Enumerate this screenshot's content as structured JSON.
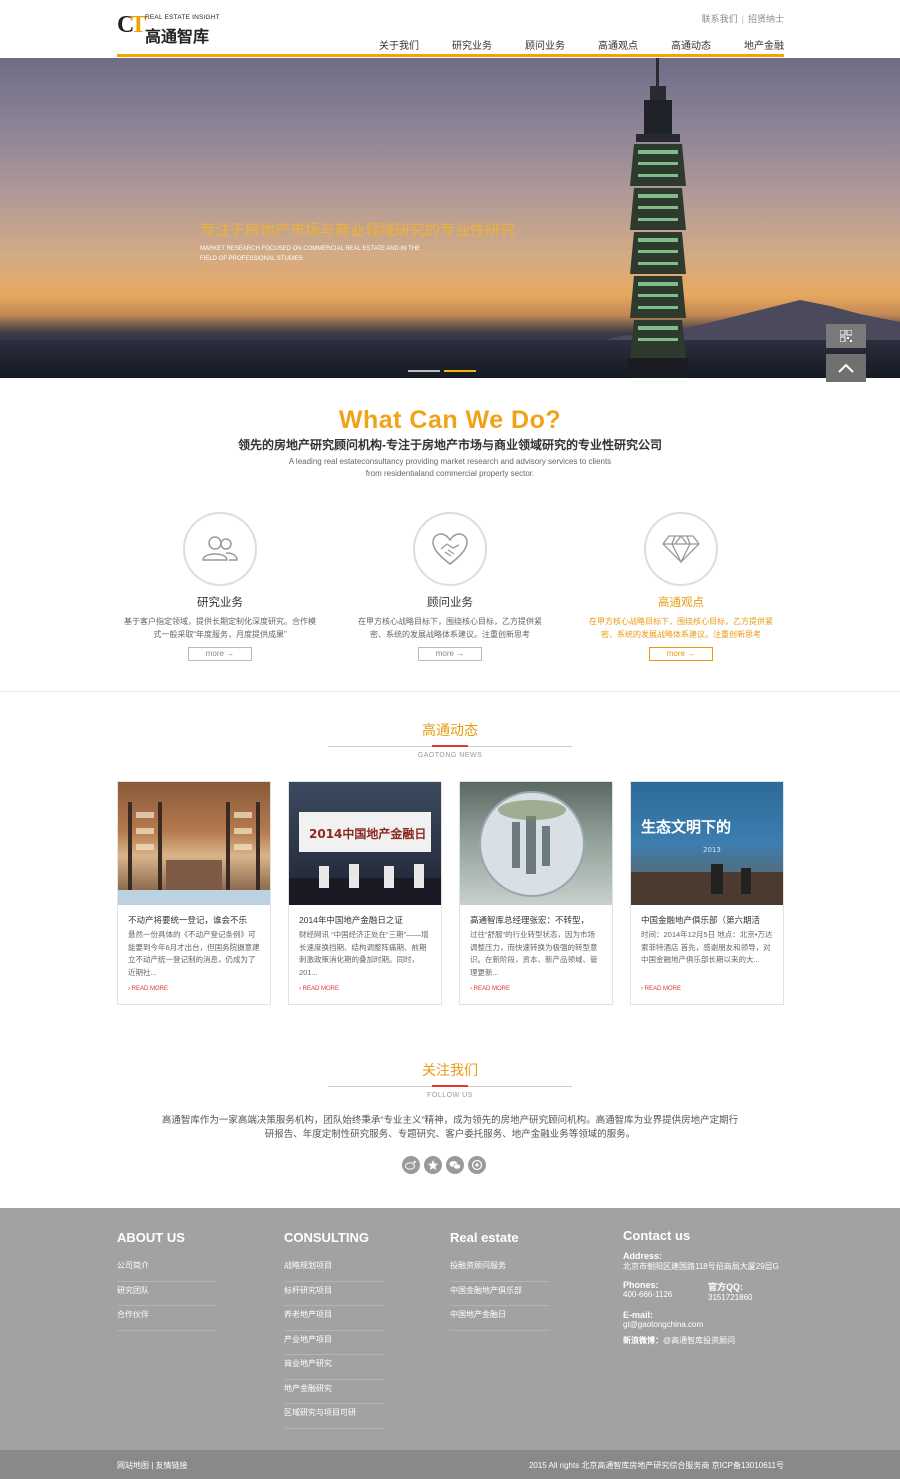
{
  "header": {
    "logo_ct": "CT",
    "logo_en": "REAL ESTATE INSIGHT",
    "logo_cn": "高通智库",
    "top_links": [
      "联系我们",
      "招贤纳士"
    ],
    "nav": [
      "关于我们",
      "研究业务",
      "顾问业务",
      "高通观点",
      "高通动态",
      "地产金融"
    ]
  },
  "banner": {
    "title": "专注于房地产市场与商业领域研究的专业性研究",
    "subtitle": "MARKET RESEARCH FOCUSED ON COMMERCIAL REAL ESTATE AND IN THE FIELD OF PROFESSIONAL STUDIES"
  },
  "what": {
    "heading": "What Can We Do?",
    "subheading": "领先的房地产研究顾问机构-专注于房地产市场与商业领域研究的专业性研究公司",
    "english": "A leading real estateconsultancy providing market research and advisory services to clients from residentialand commercial property sector."
  },
  "services": [
    {
      "title": "研究业务",
      "desc": "基于客户指定领域，提供长期定制化深度研究。合作模式一般采取“年度服务，月度提供成果”",
      "more": "more →",
      "icon": "people-icon"
    },
    {
      "title": "顾问业务",
      "desc": "在甲方核心战略目标下，围绕核心目标，乙方提供紧密、系统的发展战略体系建议。注重创新思考",
      "more": "more →",
      "icon": "handshake-heart-icon"
    },
    {
      "title": "高通观点",
      "desc": "在甲方核心战略目标下，围绕核心目标，乙方提供紧密、系统的发展战略体系建议。注重创新思考",
      "more": "more →",
      "icon": "diamond-icon"
    }
  ],
  "news_section": {
    "title": "高通动态",
    "subtitle": "GAOTONG NEWS"
  },
  "news": [
    {
      "title": "不动产将要统一登记，谁会不乐",
      "desc": "悬然一份具体的《不动产登记条例》可能要到今年6月才出台，但国务院摄意建立不动产统一登记制的消息，仍成为了近期社...",
      "more": "READ MORE"
    },
    {
      "title": "2014年中国地产金融日之证",
      "desc": "财经网讯 “中国经济正处在“三期”——增长速度换挡期、结构调整阵痛期、前期刺激政策消化期的叠加时期。同时，201...",
      "more": "READ MORE"
    },
    {
      "title": "高通智库总经理张宏：不转型，",
      "desc": "过往“舒服”的行业转型状态，因为市场调整压力，而快速转换为极强的转型意识。在新阶段，资本、新产品领域、管理更新...",
      "more": "READ MORE"
    },
    {
      "title": "中国金融地产俱乐部（第六期活",
      "desc": "时间：2014年12月5日 地点：北京•万达索菲特酒店 首先，感谢朋友和领导，对中国金融地产俱乐部长期以来的大...",
      "more": "READ MORE"
    }
  ],
  "news_image_text": {
    "slogan": "生态文明下的",
    "year": "2013",
    "poster": "2014中国地产金融日"
  },
  "follow": {
    "title": "关注我们",
    "subtitle": "FOLLOW US",
    "text": "高通智库作为一家高端决策服务机构，团队始终秉承“专业主义”精神，成为领先的房地产研究顾问机构。高通智库为业界提供房地产定期行研报告、年度定制性研究服务、专题研究、客户委托服务、地产金融业务等领域的服务。",
    "icons": [
      "weibo-icon",
      "star-icon",
      "wechat-icon",
      "chat-icon"
    ]
  },
  "footer": {
    "about": {
      "title": "ABOUT US",
      "items": [
        "公司简介",
        "研究团队",
        "合作伙伴"
      ]
    },
    "consulting": {
      "title": "CONSULTING",
      "items": [
        "战略规划项目",
        "标杆研究项目",
        "养老地产项目",
        "产业地产项目",
        "商业地产研究",
        "地产金融研究",
        "区域研究与项目可研"
      ]
    },
    "realestate": {
      "title": "Real estate",
      "items": [
        "投融资顾问服务",
        "中国金融地产俱乐部",
        "中国地产金融日"
      ]
    },
    "contact": {
      "title": "Contact us",
      "address_label": "Address:",
      "address": "北京市朝阳区建国路118号招商局大厦29层G",
      "phone_label": "Phones:",
      "phone": "400-666-1126",
      "qq_label": "官方QQ:",
      "qq": "3151721860",
      "email_label": "E-mail:",
      "email": "gt@gaotongchina.com",
      "weibo_label": "新浪微博：",
      "weibo": "@高通智库投资顾问"
    },
    "bottom_left": "网站地图 | 友情链接",
    "bottom_right": "2015 All rights 北京高通智库房地产研究综合服务商 京ICP备13010611号"
  }
}
